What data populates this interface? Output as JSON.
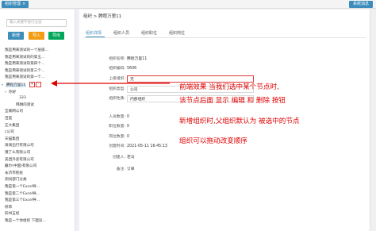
{
  "topbar": {
    "tab_label": "组织管理",
    "close": "×",
    "right_button": "系统消息"
  },
  "left": {
    "search_placeholder": "输入关键字进行过滤",
    "buttons": {
      "add": "新增",
      "import": "导入",
      "export": "导出"
    },
    "tree": [
      {
        "label": "我是用来测试的一个层级..."
      },
      {
        "label": "我是用来测试的的第五..."
      },
      {
        "label": "我是用来测试的第四个..."
      },
      {
        "label": "我是用来测试的第三个..."
      },
      {
        "label": "我是用来测试的第一个..."
      },
      {
        "label": "腾程万里11",
        "selected": true,
        "op_add": "+",
        "op_del": "-"
      },
      {
        "label": "你好"
      },
      {
        "label": "333"
      },
      {
        "label": "韩琳的测试"
      },
      {
        "label": "互联网公司"
      },
      {
        "label": "百度"
      },
      {
        "label": "正大集团"
      },
      {
        "label": "c公司"
      },
      {
        "label": "天猫集团"
      },
      {
        "label": "滴滴出行有限公司"
      },
      {
        "label": "饿了么有限公司"
      },
      {
        "label": "美团外卖有限公司"
      },
      {
        "label": "戴尔(中国)有限公司"
      },
      {
        "label": "永济市民统"
      },
      {
        "label": "测试部门分类"
      },
      {
        "label": "我是第一个Excel导..."
      },
      {
        "label": "我是第二个Excel导..."
      },
      {
        "label": "我是第三个Excel导..."
      },
      {
        "label": "修饰"
      },
      {
        "label": "四书五经"
      },
      {
        "label": "我是一个你组织 下面没..."
      }
    ]
  },
  "main": {
    "breadcrumb": "组织 > 腾程万里11",
    "tabs": [
      "组织详情",
      "组织人员",
      "组织职位",
      "组织岗位"
    ],
    "fields": [
      {
        "key": "组织名称:",
        "value": "腾程万里11"
      },
      {
        "key": "组织编码:",
        "value": "5606"
      },
      {
        "key": "上级组织:",
        "value": "无"
      },
      {
        "key": "组织类型:",
        "value": "公司"
      },
      {
        "key": "组织性质:",
        "value": "内部组织"
      },
      {
        "key": "人员数量:",
        "value": "0"
      },
      {
        "key": "职位数量:",
        "value": "0"
      },
      {
        "key": "岗位数量:",
        "value": "0"
      },
      {
        "key": "创建时间:",
        "value": "2021-05-11 16:45:13"
      },
      {
        "key": "创建人:",
        "value": "老马"
      },
      {
        "key": "备注:",
        "value": "订单"
      }
    ]
  },
  "annotation": {
    "line1": "前端效果    当我们选中某个节点时,",
    "line2": "该节点后面    显示  编辑    和  删除    按钮",
    "line3": "新增组织时,父组织默认为    被选中的节点",
    "line4": "组织可以拖动改变顺序",
    "color": "#e00000"
  }
}
